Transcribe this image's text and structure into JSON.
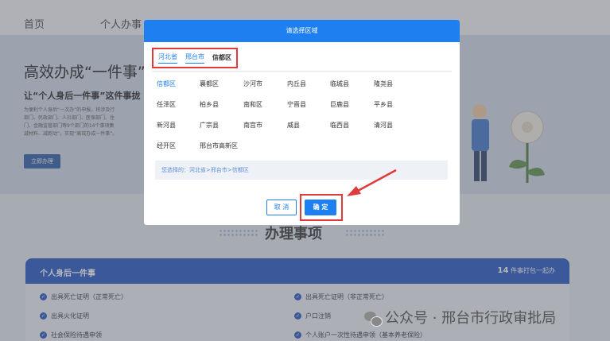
{
  "nav": {
    "items": [
      "首页",
      "个人办事"
    ]
  },
  "hero": {
    "title": "高效办成“一件事”，",
    "subtitle": "让“个人身后一件事”这件事拢",
    "description_lines": [
      "为便利个人身后“一次办”的申报，将涉及行",
      "部门、民政部门、人社部门、医保部门、住",
      "门、金融监管部门等9个部门的14个事项集",
      "减材料、减跑动”，实现“高效办成一件事”。"
    ],
    "button_label": "立即办理"
  },
  "section": {
    "title": "办理事项"
  },
  "service_panel": {
    "title": "个人身后一件事",
    "count_number": "14",
    "count_text": "件事打包一起办",
    "items": [
      "出具死亡证明（正常死亡）",
      "出具死亡证明（非正常死亡）",
      "出具火化证明",
      "户口注销",
      "社会保险待遇申领",
      "个人账户一次性待遇申领（基本养老保险）"
    ]
  },
  "watermark": {
    "text": "公众号 · 邢台市行政审批局",
    "icon": "wechat-icon"
  },
  "modal": {
    "title": "请选择区域",
    "breadcrumbs": [
      "河北省",
      "邢台市",
      "信都区"
    ],
    "districts": [
      [
        "信都区",
        "襄都区",
        "沙河市",
        "内丘县",
        "临城县",
        "隆尧县"
      ],
      [
        "任泽区",
        "柏乡县",
        "南和区",
        "宁晋县",
        "巨鹿县",
        "平乡县"
      ],
      [
        "新河县",
        "广宗县",
        "南宫市",
        "威县",
        "临西县",
        "清河县"
      ],
      [
        "经开区",
        "邢台市高新区"
      ]
    ],
    "selected_district": "信都区",
    "selected_label": "您选择的：",
    "selected_path": "河北省>邢台市>信都区",
    "cancel_label": "取 消",
    "confirm_label": "确 定"
  },
  "colors": {
    "primary": "#1e7ff0",
    "highlight": "#e03a3a",
    "nav_blue": "#2255c4"
  }
}
